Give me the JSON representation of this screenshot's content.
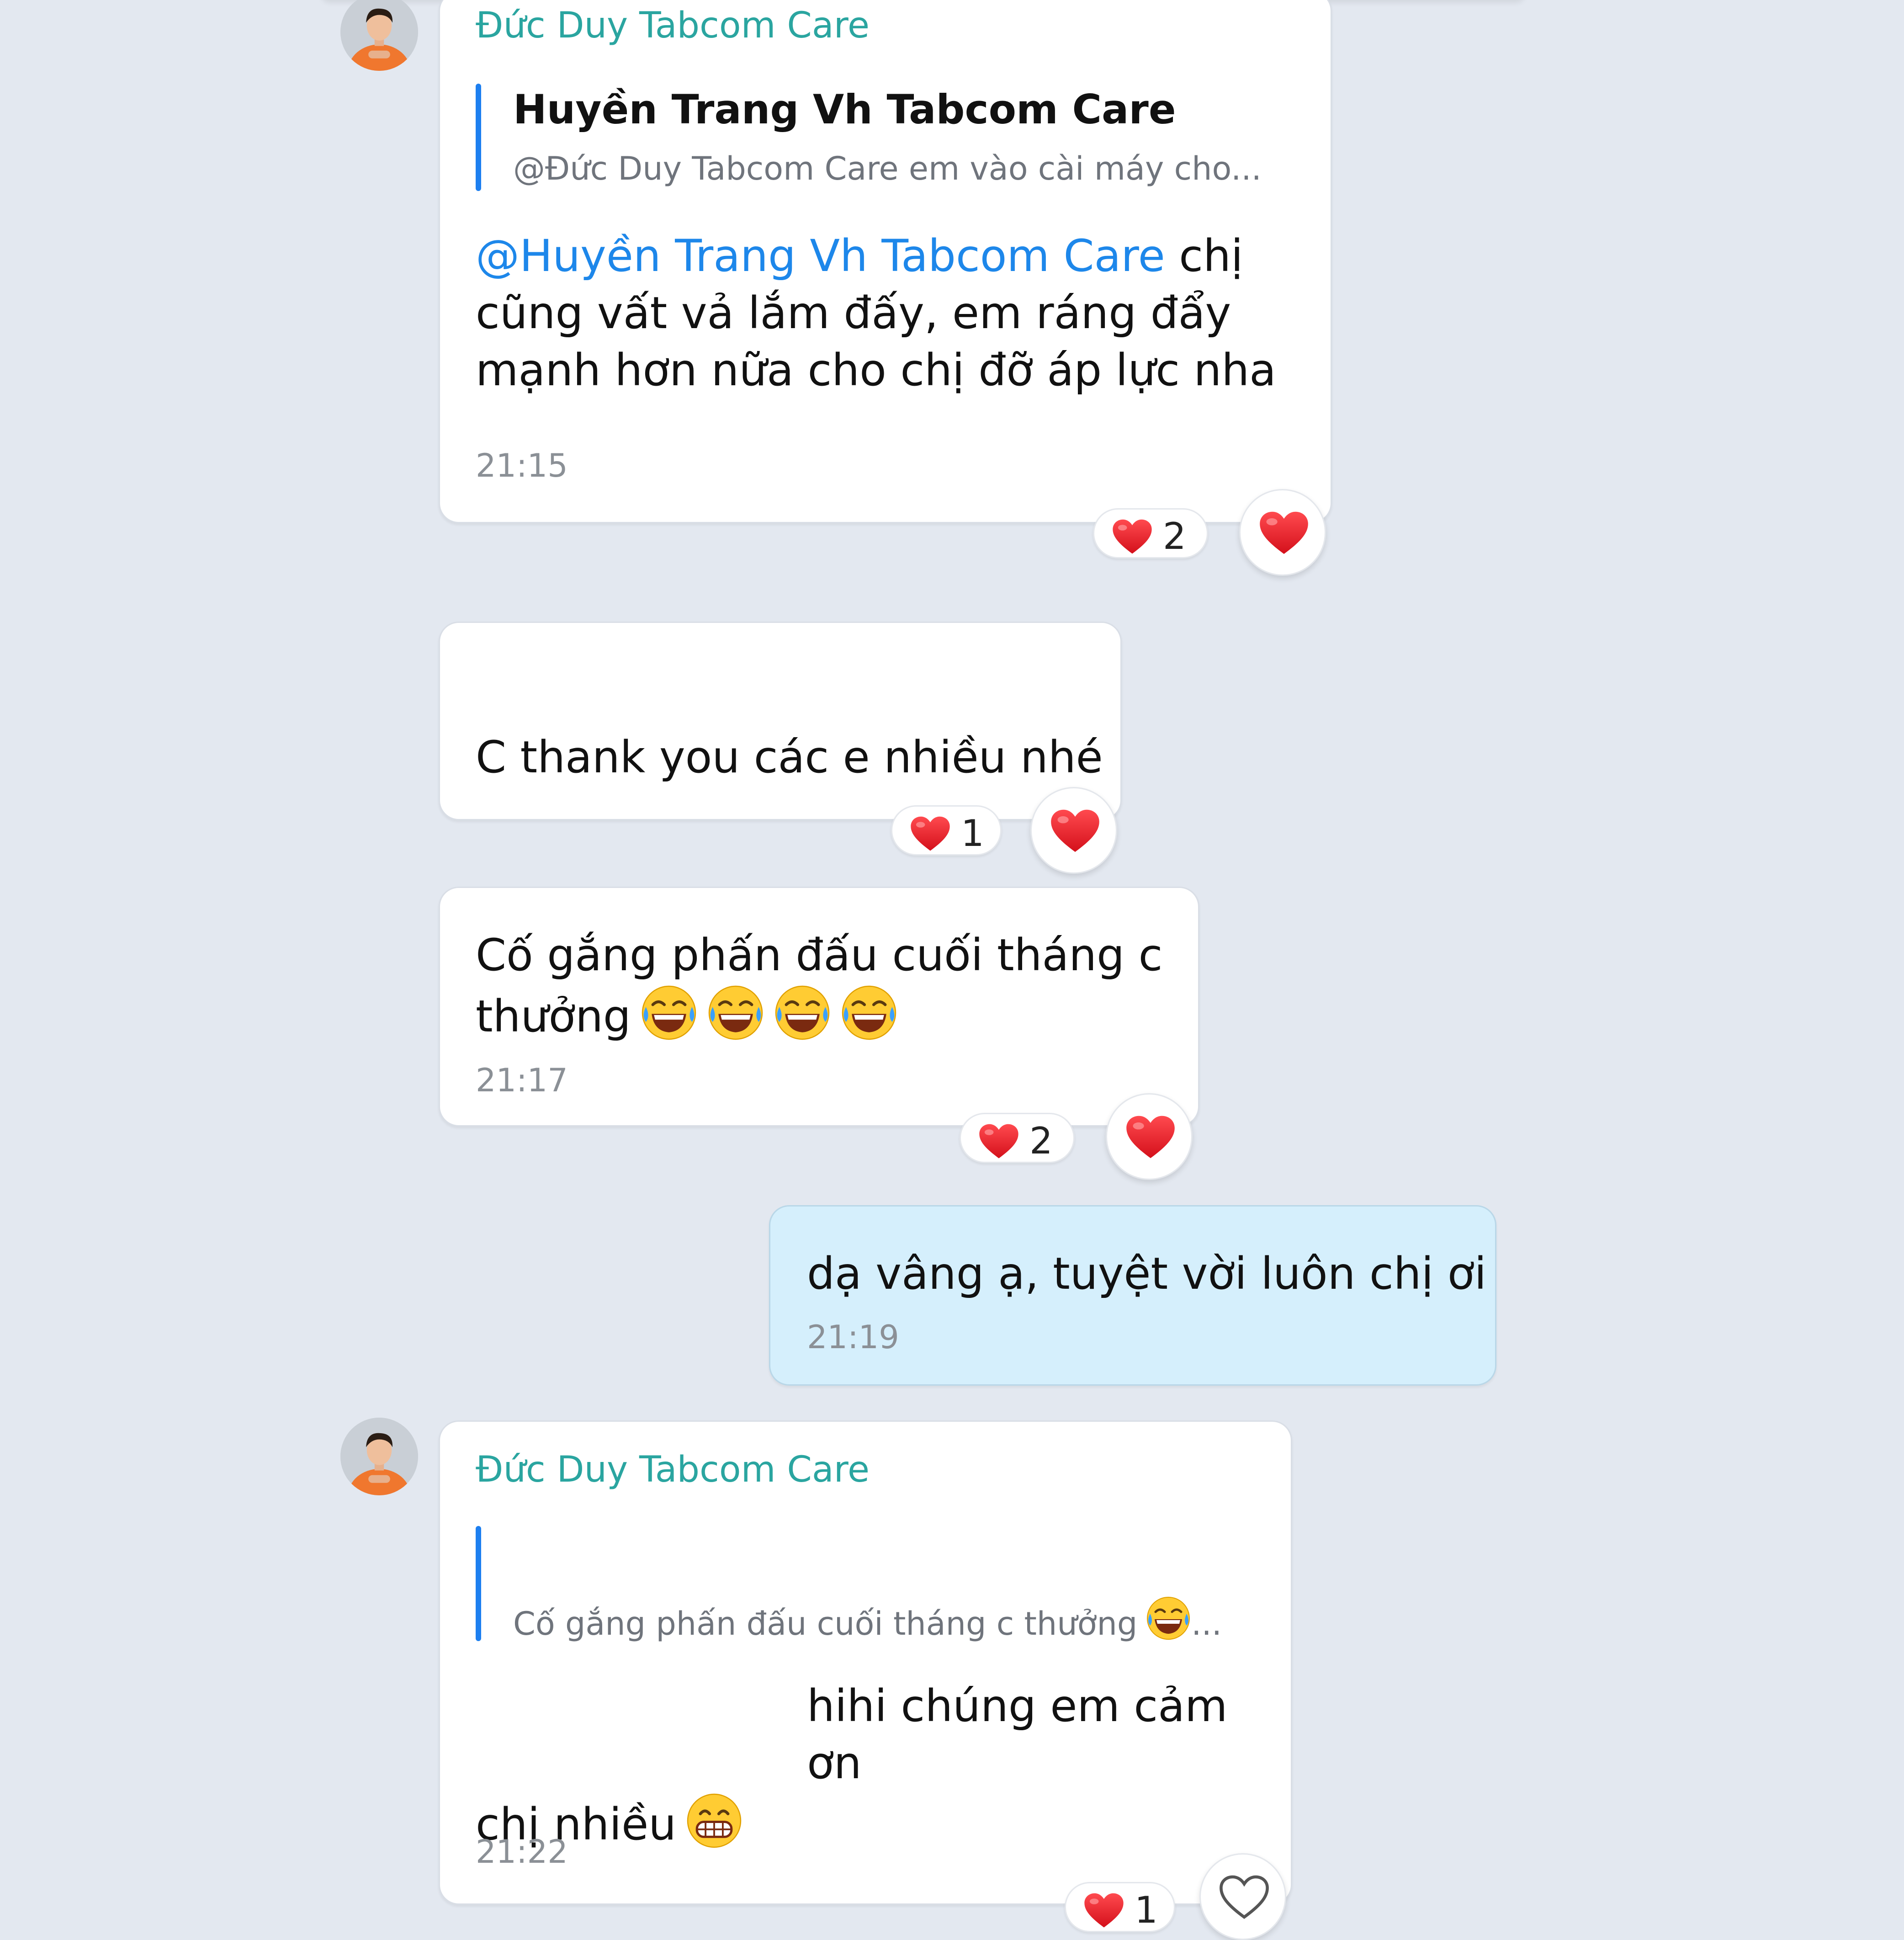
{
  "conversation": {
    "messages": [
      {
        "sender": "Đức Duy Tabcom Care",
        "quote_name": "Huyền Trang Vh Tabcom Care",
        "quote_text": "@Đức Duy Tabcom Care em vào cài máy cho...",
        "mention": "@Huyền Trang Vh Tabcom Care",
        "text_line1_rest": " chị",
        "text_line2": "cũng vất vả lắm đấy, em ráng đẩy",
        "text_line3": "mạnh hơn nữa cho chị đỡ áp lực nha",
        "time": "21:15",
        "reaction_count": "2"
      },
      {
        "text": "C thank you các e nhiều nhé",
        "reaction_count": "1"
      },
      {
        "text_line1": "Cố gắng phấn đấu cuối tháng c",
        "text_line2": "thưởng",
        "time": "21:17",
        "reaction_count": "2"
      },
      {
        "text": "dạ vâng ạ, tuyệt vời luôn chị ơi",
        "time": "21:19"
      },
      {
        "sender": "Đức Duy Tabcom Care",
        "quote_text": "Cố gắng phấn đấu cuối tháng c thưởng",
        "quote_ellipsis": "...",
        "text_line1": "hihi chúng em cảm ơn",
        "text_line2": "chị nhiều",
        "time": "21:22",
        "reaction_count": "1"
      }
    ]
  },
  "colors": {
    "background": "#e3e8f0",
    "sender_name": "#2aa5a0",
    "mention": "#1d87ea",
    "quote_bar": "#1d7ff0",
    "self_bubble": "#d5effc",
    "heart": "#e8202a"
  },
  "icons": [
    "avatar",
    "heart-icon",
    "heart-outline-icon",
    "laughing-tears-emoji",
    "grinning-emoji"
  ]
}
